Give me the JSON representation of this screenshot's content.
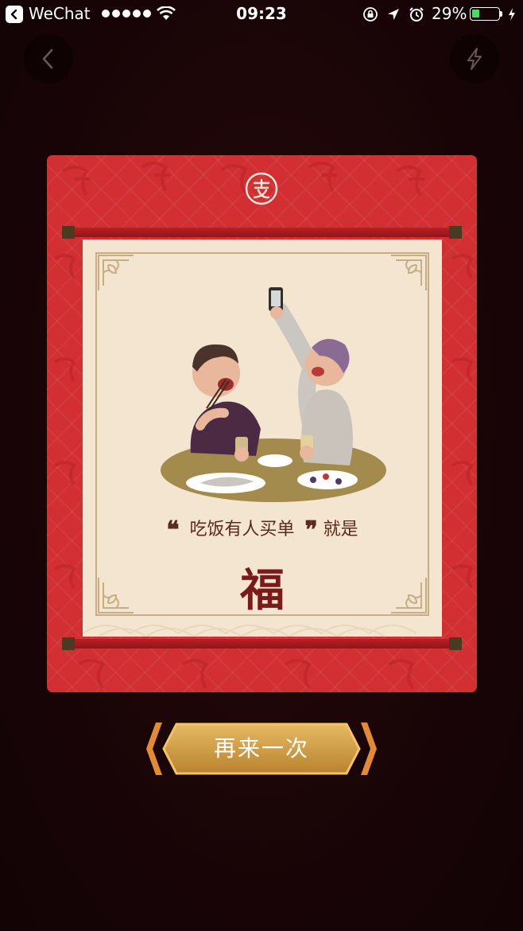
{
  "status_bar": {
    "app_name": "WeChat",
    "time": "09:23",
    "battery_percent": "29%",
    "battery_level": 0.29,
    "signal_dots": 5
  },
  "top_controls": {
    "back_icon": "chevron-left-icon",
    "flash_icon": "lightning-icon"
  },
  "card": {
    "logo_icon": "alipay-logo-icon",
    "slogan_quote_open": "❝",
    "slogan_text": "吃饭有人买单",
    "slogan_quote_close": "❞",
    "slogan_suffix": "就是",
    "fu_character": "福",
    "colors": {
      "card_red": "#d22f33",
      "scroll_bg": "#f4e5d1",
      "text_brown": "#5b2a1c"
    }
  },
  "retry_button": {
    "label": "再来一次",
    "color": "#d4a24a"
  }
}
